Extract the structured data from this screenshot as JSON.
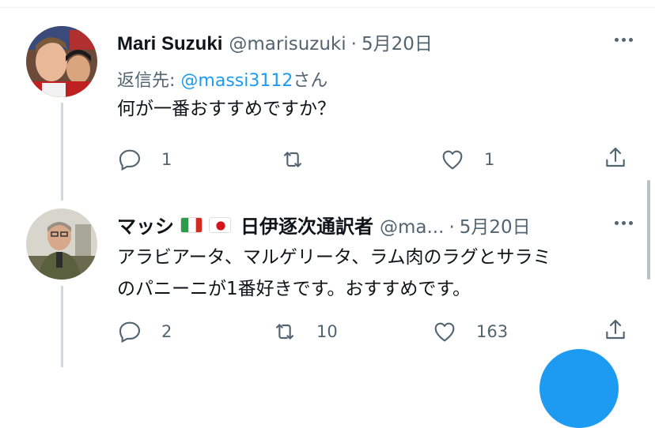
{
  "tweets": [
    {
      "name": "Mari Suzuki",
      "handle": "@marisuzuki",
      "separator": "·",
      "date": "5月20日",
      "reply_prefix": "返信先: ",
      "reply_mention": "@massi3112",
      "reply_suffix": "さん",
      "text": "何が一番おすすめですか？",
      "replies": "1",
      "retweets": "",
      "likes": "1"
    },
    {
      "name": "マッシ",
      "name_suffix": "日伊逐次通訳者",
      "handle": "@ma...",
      "separator": "·",
      "date": "5月20日",
      "text_line1": "アラビアータ、マルゲリータ、ラム肉のラグとサラミ",
      "text_line2": "のパニーニが1番好きです。おすすめです。",
      "replies": "2",
      "retweets": "10",
      "likes": "163"
    }
  ],
  "flags": [
    "italy-flag",
    "japan-flag"
  ],
  "icons": [
    "reply-icon",
    "retweet-icon",
    "like-icon",
    "share-icon",
    "more-icon"
  ],
  "colors": {
    "accent": "#1d9bf0",
    "secondary_text": "#536471",
    "thread_line": "#cfd9de"
  }
}
